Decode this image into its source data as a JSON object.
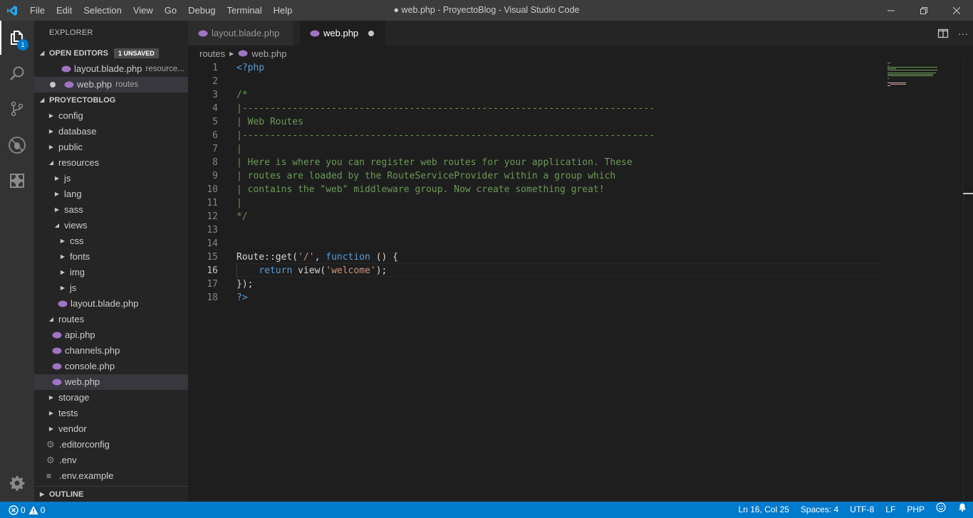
{
  "window": {
    "title": "● web.php - ProyectoBlog - Visual Studio Code",
    "menu": [
      "File",
      "Edit",
      "Selection",
      "View",
      "Go",
      "Debug",
      "Terminal",
      "Help"
    ]
  },
  "activity": {
    "explorer_badge": "1"
  },
  "sidebar": {
    "title": "EXPLORER",
    "open_editors": {
      "header": "OPEN EDITORS",
      "badge": "1 UNSAVED",
      "items": [
        {
          "name": "layout.blade.php",
          "desc": "resource..."
        },
        {
          "name": "web.php",
          "desc": "routes"
        }
      ]
    },
    "project": {
      "header": "PROYECTOBLOG",
      "tree": [
        {
          "label": "config"
        },
        {
          "label": "database"
        },
        {
          "label": "public"
        },
        {
          "label": "resources"
        },
        {
          "label": "js"
        },
        {
          "label": "lang"
        },
        {
          "label": "sass"
        },
        {
          "label": "views"
        },
        {
          "label": "css"
        },
        {
          "label": "fonts"
        },
        {
          "label": "img"
        },
        {
          "label": "js"
        },
        {
          "label": "layout.blade.php"
        },
        {
          "label": "routes"
        },
        {
          "label": "api.php"
        },
        {
          "label": "channels.php"
        },
        {
          "label": "console.php"
        },
        {
          "label": "web.php"
        },
        {
          "label": "storage"
        },
        {
          "label": "tests"
        },
        {
          "label": "vendor"
        },
        {
          "label": ".editorconfig"
        },
        {
          "label": ".env"
        },
        {
          "label": ".env.example"
        }
      ]
    },
    "outline": "OUTLINE"
  },
  "tabs": [
    {
      "label": "layout.blade.php"
    },
    {
      "label": "web.php"
    }
  ],
  "breadcrumb": {
    "folder": "routes",
    "file": "web.php"
  },
  "editor": {
    "line_numbers": [
      "1",
      "2",
      "3",
      "4",
      "5",
      "6",
      "7",
      "8",
      "9",
      "10",
      "11",
      "12",
      "13",
      "14",
      "15",
      "16",
      "17",
      "18"
    ],
    "lines": {
      "l1": "<?php",
      "l3": "/*",
      "l4": "|--------------------------------------------------------------------------",
      "l5": "| Web Routes",
      "l6": "|--------------------------------------------------------------------------",
      "l7": "|",
      "l8": "| Here is where you can register web routes for your application. These",
      "l9": "| routes are loaded by the RouteServiceProvider within a group which",
      "l10": "| contains the \"web\" middleware group. Now create something great!",
      "l11": "|",
      "l12": "*/",
      "l15a": "Route::",
      "l15b": "get",
      "l15c": "(",
      "l15d": "'/'",
      "l15e": ", ",
      "l15f": "function",
      "l15g": " () {",
      "l16a": "    ",
      "l16b": "return",
      "l16c": " ",
      "l16d": "view",
      "l16e": "(",
      "l16f": "'welcome'",
      "l16g": ");",
      "l17": "});",
      "l18": "?>"
    }
  },
  "status": {
    "errors": "0",
    "warnings": "0",
    "position": "Ln 16, Col 25",
    "spaces": "Spaces: 4",
    "encoding": "UTF-8",
    "eol": "LF",
    "language": "PHP"
  },
  "colors": {
    "accent": "#007acc",
    "comment": "#6a9955",
    "keyword": "#569cd6",
    "string": "#ce9178",
    "php_icon": "#a074c4"
  }
}
